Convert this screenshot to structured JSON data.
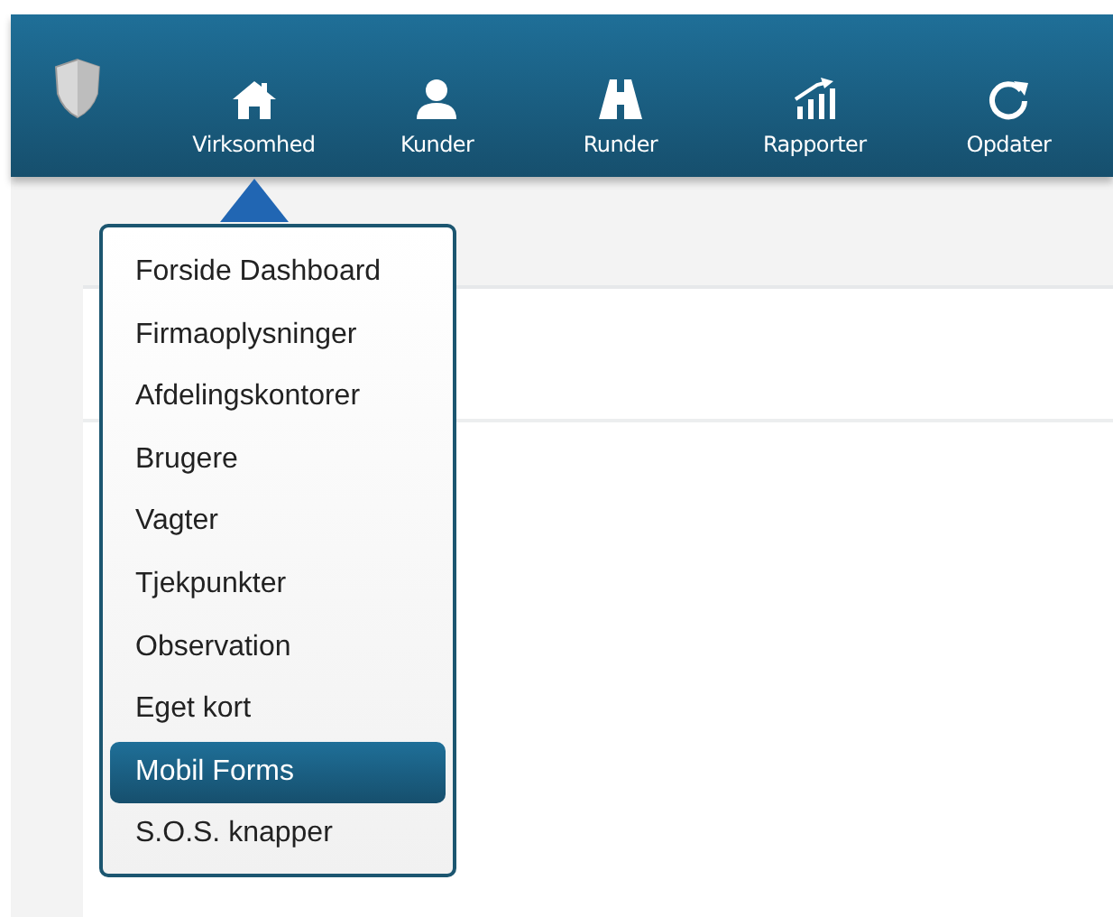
{
  "nav": [
    {
      "label": "Virksomhed",
      "selected": true
    },
    {
      "label": "Kunder",
      "selected": false
    },
    {
      "label": "Runder",
      "selected": false
    },
    {
      "label": "Rapporter",
      "selected": false
    },
    {
      "label": "Opdater",
      "selected": false
    }
  ],
  "menu": [
    {
      "label": "Forside Dashboard",
      "selected": false
    },
    {
      "label": "Firmaoplysninger",
      "selected": false
    },
    {
      "label": "Afdelingskontorer",
      "selected": false
    },
    {
      "label": "Brugere",
      "selected": false
    },
    {
      "label": "Vagter",
      "selected": false
    },
    {
      "label": "Tjekpunkter",
      "selected": false
    },
    {
      "label": "Observation",
      "selected": false
    },
    {
      "label": "Eget kort",
      "selected": false
    },
    {
      "label": "Mobil Forms",
      "selected": true
    },
    {
      "label": "S.O.S. knapper",
      "selected": false
    }
  ]
}
